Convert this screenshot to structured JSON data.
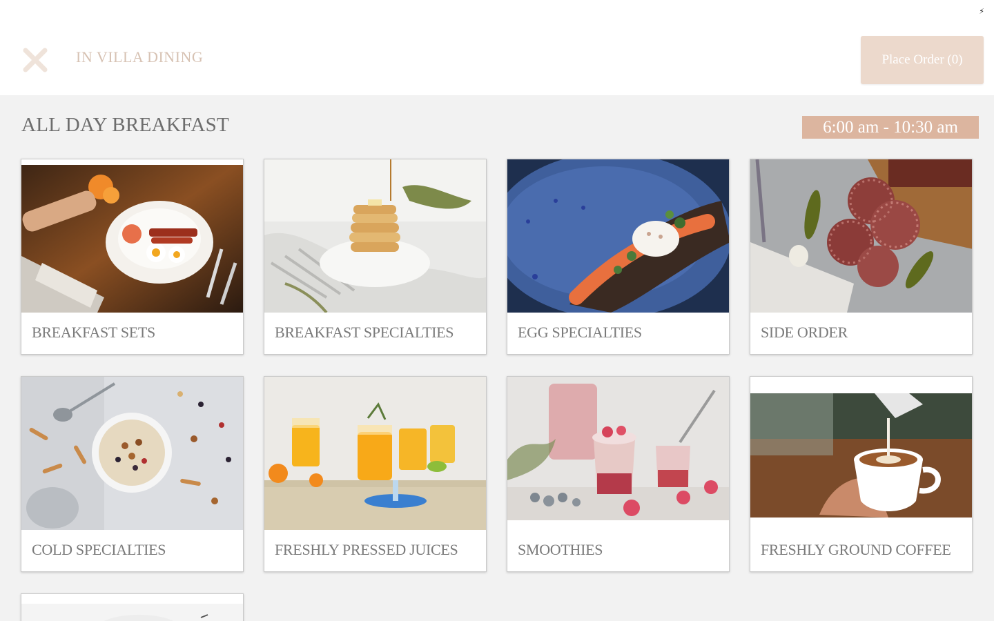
{
  "header": {
    "title": "IN VILLA DINING",
    "place_order_label": "Place Order (0)",
    "status_glyph": "⚡"
  },
  "section": {
    "title": "ALL DAY BREAKFAST",
    "hours": "6:00 am - 10:30 am"
  },
  "colors": {
    "accent": "#dcb59f",
    "accent_light": "#ecd9cc",
    "close_icon": "#efe3da",
    "title_text": "#d7c2b3",
    "background": "#f2f2f2"
  },
  "categories": [
    {
      "label": "BREAKFAST SETS",
      "icon": "breakfast-sets-photo"
    },
    {
      "label": "BREAKFAST SPECIALTIES",
      "icon": "pancakes-photo"
    },
    {
      "label": "EGG SPECIALTIES",
      "icon": "poached-egg-photo"
    },
    {
      "label": "SIDE ORDER",
      "icon": "salami-photo"
    },
    {
      "label": "COLD SPECIALTIES",
      "icon": "muesli-photo"
    },
    {
      "label": "FRESHLY PRESSED JUICES",
      "icon": "orange-juice-photo"
    },
    {
      "label": "SMOOTHIES",
      "icon": "smoothie-photo"
    },
    {
      "label": "FRESHLY GROUND COFFEE",
      "icon": "coffee-photo"
    }
  ]
}
